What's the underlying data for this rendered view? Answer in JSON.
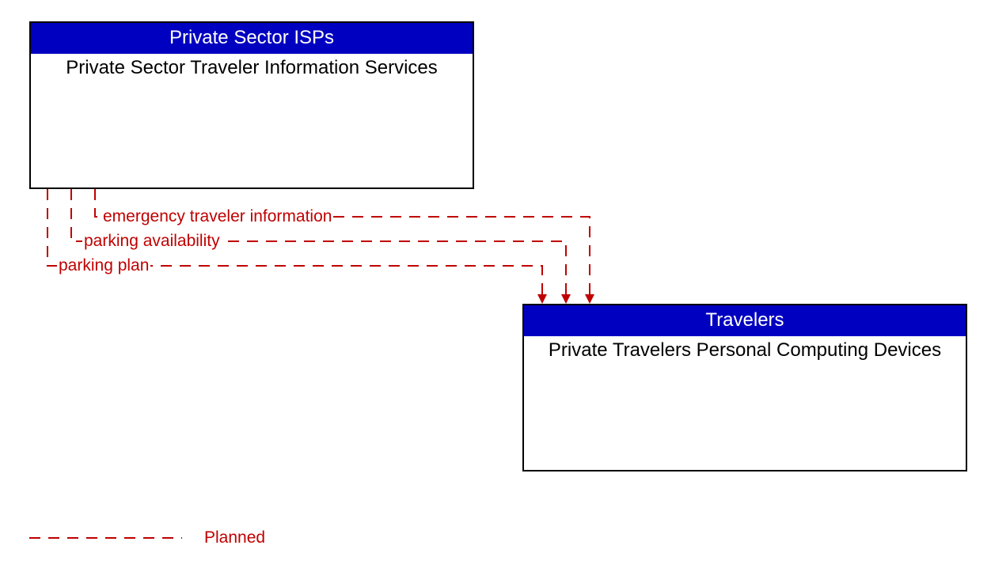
{
  "nodes": {
    "source": {
      "header": "Private Sector ISPs",
      "body": "Private Sector Traveler Information Services"
    },
    "target": {
      "header": "Travelers",
      "body": "Private Travelers Personal Computing Devices"
    }
  },
  "flows": {
    "f1": "emergency traveler information",
    "f2": "parking availability",
    "f3": "parking plan"
  },
  "legend": {
    "planned": "Planned"
  },
  "colors": {
    "header_bg": "#0000c0",
    "line": "#c00000"
  }
}
